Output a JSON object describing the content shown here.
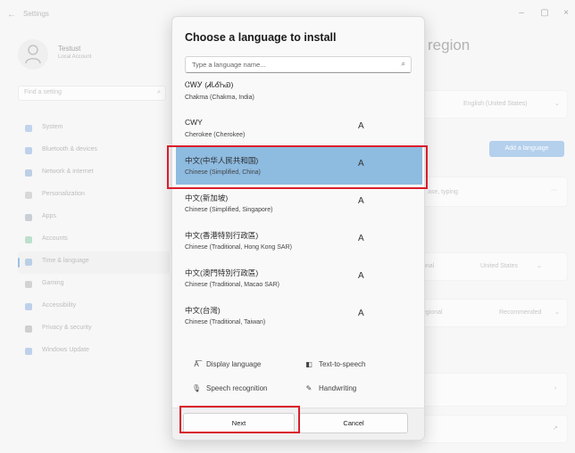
{
  "app": {
    "title": "Settings",
    "window_controls": {
      "minimize": "–",
      "maximize": "▢",
      "close": "×"
    },
    "profile": {
      "name": "Testust",
      "account": "Local Account"
    },
    "find": {
      "placeholder": "Find a setting"
    },
    "nav": [
      {
        "label": "System",
        "icon": "monitor-icon",
        "color": "#3b7fd1"
      },
      {
        "label": "Bluetooth & devices",
        "icon": "bluetooth-icon",
        "color": "#2e74c8"
      },
      {
        "label": "Network & internet",
        "icon": "wifi-icon",
        "color": "#2d6ab7"
      },
      {
        "label": "Personalization",
        "icon": "brush-icon",
        "color": "#8a8a8a"
      },
      {
        "label": "Apps",
        "icon": "apps-icon",
        "color": "#5a6a80"
      },
      {
        "label": "Accounts",
        "icon": "person-icon",
        "color": "#2fa26a"
      },
      {
        "label": "Time & language",
        "icon": "globe-clock-icon",
        "color": "#2e74c8",
        "active": true
      },
      {
        "label": "Gaming",
        "icon": "controller-icon",
        "color": "#7a7a7a"
      },
      {
        "label": "Accessibility",
        "icon": "accessibility-icon",
        "color": "#2e74c8"
      },
      {
        "label": "Privacy & security",
        "icon": "shield-icon",
        "color": "#6a6a6a"
      },
      {
        "label": "Windows Update",
        "icon": "update-icon",
        "color": "#2e74c8"
      }
    ],
    "region_title": "region",
    "right_texts": {
      "display_lang": "English (United States)",
      "add_language": "Add a language",
      "typing": "ase, typing",
      "country": "United States",
      "country_label": "onal",
      "format_label": "egional",
      "format_value": "Recommended"
    }
  },
  "dialog": {
    "title": "Choose a language to install",
    "search_placeholder": "Type a language name...",
    "languages": [
      {
        "native": "ᏣᎳᎩ (ᏗᏓᎴᏂᏯ)",
        "english": "Chakma (Chakma, India)",
        "feature": ""
      },
      {
        "native": "CWY",
        "english": "Cherokee (Cherokee)",
        "feature": "A"
      },
      {
        "native": "中文(中华人民共和国)",
        "english": "Chinese (Simplified, China)",
        "feature": "A",
        "selected": true
      },
      {
        "native": "中文(新加坡)",
        "english": "Chinese (Simplified, Singapore)",
        "feature": "A"
      },
      {
        "native": "中文(香港特别行政區)",
        "english": "Chinese (Traditional, Hong Kong SAR)",
        "feature": "A"
      },
      {
        "native": "中文(澳門特別行政區)",
        "english": "Chinese (Traditional, Macao SAR)",
        "feature": "A"
      },
      {
        "native": "中文(台灣)",
        "english": "Chinese (Traditional, Taiwan)",
        "feature": "A"
      }
    ],
    "features": {
      "display_language": "Display language",
      "text_to_speech": "Text-to-speech",
      "speech_recognition": "Speech recognition",
      "handwriting": "Handwriting"
    },
    "buttons": {
      "next": "Next",
      "cancel": "Cancel"
    }
  }
}
